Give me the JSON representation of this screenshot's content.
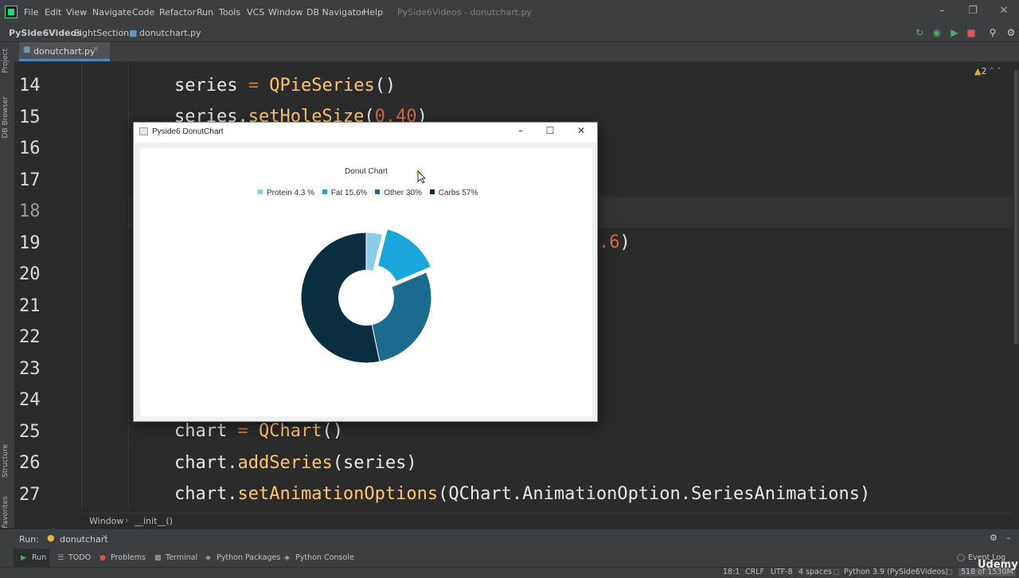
{
  "menu": {
    "items": [
      "File",
      "Edit",
      "View",
      "Navigate",
      "Code",
      "Refactor",
      "Run",
      "Tools",
      "VCS",
      "Window",
      "DB Navigator",
      "Help"
    ],
    "window_title": "PySide6Videos - donutchart.py"
  },
  "nav": {
    "project": "PySide6Videos",
    "folder": "EightSection",
    "file": "donutchart.py",
    "run_config": "donutchart"
  },
  "editor": {
    "tab_label": "donutchart.py",
    "warnings": "2",
    "line_numbers": [
      "14",
      "15",
      "16",
      "17",
      "18",
      "19",
      "20",
      "21",
      "22",
      "23",
      "24",
      "25",
      "26",
      "27"
    ],
    "code": {
      "l14_var": "series",
      "l14_eq": " = ",
      "l14_cls": "QPieSeries",
      "l14_end": "()",
      "l15_a": "series.",
      "l15_fn": "setHoleSize",
      "l15_p1": "(",
      "l15_num": "0.40",
      "l15_p2": ")",
      "l19_tail_num": ".6",
      "l19_tail_p": ")",
      "l25_a": "chart",
      "l25_eq": " = ",
      "l25_cls": "QChart",
      "l25_end": "()",
      "l26_a": "chart.",
      "l26_fn": "addSeries",
      "l26_b": "(series)",
      "l27_a": "chart.",
      "l27_fn": "setAnimationOptions",
      "l27_b": "(QChart.AnimationOption.SeriesAnimations)"
    },
    "breadcrumb": [
      "Window",
      "__init__()"
    ]
  },
  "left_strip": [
    "Project",
    "DB Browser",
    "Structure",
    "Favorites"
  ],
  "run_panel": {
    "label": "Run:",
    "config": "donutchart"
  },
  "tool_tabs": [
    "Run",
    "TODO",
    "Problems",
    "Terminal",
    "Python Packages",
    "Python Console"
  ],
  "event_log": "Event Log",
  "status": {
    "position": "18:1",
    "line_sep": "CRLF",
    "encoding": "UTF-8",
    "indent": "4 spaces",
    "interpreter": "Python 3.9 (PySide6Videos)",
    "memory": "518 of 1530M"
  },
  "watermark": "Udemy",
  "qt_window": {
    "title": "Pyside6 DonutChart",
    "chart_title": "Donut Chart",
    "legend": [
      {
        "label": "Protein 4.3 %",
        "color": "#89cde9"
      },
      {
        "label": "Fat 15.6%",
        "color": "#1aa6db"
      },
      {
        "label": "Other 30%",
        "color": "#1c6a8f"
      },
      {
        "label": "Carbs 57%",
        "color": "#0a2d40"
      }
    ]
  },
  "chart_data": {
    "type": "pie",
    "title": "Donut Chart",
    "hole_size": 0.4,
    "categories": [
      "Protein 4.3 %",
      "Fat 15.6%",
      "Other 30%",
      "Carbs 57%"
    ],
    "values": [
      4.3,
      15.6,
      30,
      57
    ],
    "exploded": [
      "Fat 15.6%"
    ],
    "colors": [
      "#89cde9",
      "#1aa6db",
      "#1c6a8f",
      "#0a2d40"
    ],
    "legend_position": "top"
  }
}
